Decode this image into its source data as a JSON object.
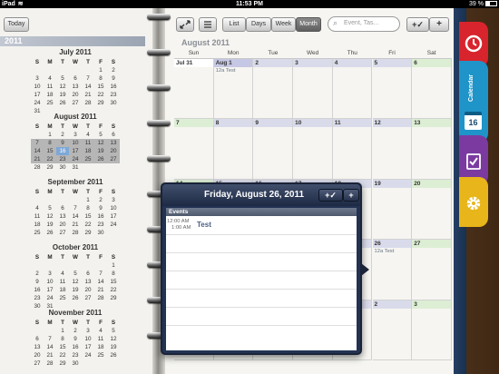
{
  "status_bar": {
    "device": "iPad",
    "time": "11:53 PM",
    "battery": "39 %",
    "battery_level": 0.39
  },
  "toolbar": {
    "today_label": "Today",
    "views": [
      "List",
      "Days",
      "Week",
      "Month"
    ],
    "selected_view": "Month",
    "search_placeholder": "Event, Tas..."
  },
  "sidebar": {
    "year": "2011",
    "weekday_headers": [
      "S",
      "M",
      "T",
      "W",
      "T",
      "F",
      "S"
    ],
    "months": [
      {
        "title": "July 2011",
        "lead": 5,
        "days": 31
      },
      {
        "title": "August 2011",
        "lead": 1,
        "days": 31,
        "selection": [
          [
            7,
            27
          ]
        ],
        "today": 16
      },
      {
        "title": "September 2011",
        "lead": 4,
        "days": 30
      },
      {
        "title": "October 2011",
        "lead": 6,
        "days": 31
      },
      {
        "title": "November 2011",
        "lead": 2,
        "days": 30
      }
    ]
  },
  "main": {
    "month_title": "August 2011",
    "weekday_headers": [
      "Sun",
      "Mon",
      "Tue",
      "Wed",
      "Thu",
      "Fri",
      "Sat"
    ],
    "weeks": [
      [
        {
          "label": "Jul 31",
          "style": "wkd"
        },
        {
          "label": "Aug 1",
          "style": "cur",
          "event": "12a Test"
        },
        {
          "label": "2"
        },
        {
          "label": "3"
        },
        {
          "label": "4"
        },
        {
          "label": "5"
        },
        {
          "label": "6",
          "style": "we"
        }
      ],
      [
        {
          "label": "7",
          "style": "we"
        },
        {
          "label": "8"
        },
        {
          "label": "9"
        },
        {
          "label": "10"
        },
        {
          "label": "11"
        },
        {
          "label": "12"
        },
        {
          "label": "13",
          "style": "we"
        }
      ],
      [
        {
          "label": "14",
          "style": "we"
        },
        {
          "label": "15"
        },
        {
          "label": "16"
        },
        {
          "label": "17"
        },
        {
          "label": "18"
        },
        {
          "label": "19"
        },
        {
          "label": "20",
          "style": "we"
        }
      ],
      [
        {
          "label": "21",
          "style": "we"
        },
        {
          "label": "22"
        },
        {
          "label": "23"
        },
        {
          "label": "24"
        },
        {
          "label": "25"
        },
        {
          "label": "26",
          "event": "12a Test"
        },
        {
          "label": "27",
          "style": "we"
        }
      ],
      [
        {
          "label": "28",
          "style": "we"
        },
        {
          "label": "29"
        },
        {
          "label": "30"
        },
        {
          "label": "31"
        },
        {
          "label": "Sep 1"
        },
        {
          "label": "2"
        },
        {
          "label": "3",
          "style": "we"
        }
      ]
    ]
  },
  "popover": {
    "title": "Friday, August 26, 2011",
    "add_task_icon": "+✓",
    "add_label": "+",
    "section": "Events",
    "events": [
      {
        "start": "12:00 AM",
        "end": "1:00 AM",
        "title": "Test"
      }
    ]
  },
  "tabs": [
    {
      "name": "alarm",
      "color": "#d8242c",
      "icon": "alarm-clock-icon"
    },
    {
      "name": "calendar",
      "label": "Calendar",
      "color": "#1f94c8",
      "icon": "calendar-icon",
      "date": "16"
    },
    {
      "name": "tasks",
      "color": "#7b3aa0",
      "icon": "checklist-icon"
    },
    {
      "name": "settings",
      "color": "#e8b51a",
      "icon": "gear-icon"
    }
  ]
}
